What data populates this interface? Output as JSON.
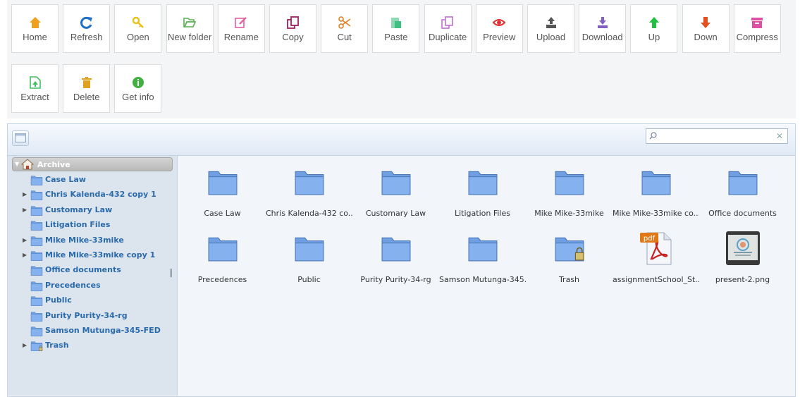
{
  "toolbar": {
    "buttons": [
      {
        "label": "Home",
        "icon": "home-icon",
        "color": "#f0a020"
      },
      {
        "label": "Refresh",
        "icon": "refresh-icon",
        "color": "#1e70c8"
      },
      {
        "label": "Open",
        "icon": "key-icon",
        "color": "#e8c020"
      },
      {
        "label": "New folder",
        "icon": "folder-open-icon",
        "color": "#58b050"
      },
      {
        "label": "Rename",
        "icon": "edit-icon",
        "color": "#e060a0"
      },
      {
        "label": "Copy",
        "icon": "copy-icon",
        "color": "#a02060"
      },
      {
        "label": "Cut",
        "icon": "scissors-icon",
        "color": "#e08020"
      },
      {
        "label": "Paste",
        "icon": "paste-icon",
        "color": "#40c080"
      },
      {
        "label": "Duplicate",
        "icon": "duplicate-icon",
        "color": "#c070d0"
      },
      {
        "label": "Preview",
        "icon": "eye-icon",
        "color": "#e03030"
      },
      {
        "label": "Upload",
        "icon": "upload-icon",
        "color": "#555555"
      },
      {
        "label": "Download",
        "icon": "download-icon",
        "color": "#8060c0"
      },
      {
        "label": "Up",
        "icon": "arrow-up-icon",
        "color": "#20c040"
      },
      {
        "label": "Down",
        "icon": "arrow-down-icon",
        "color": "#e05020"
      },
      {
        "label": "Compress",
        "icon": "archive-icon",
        "color": "#e050a0"
      },
      {
        "label": "Extract",
        "icon": "extract-icon",
        "color": "#40c060"
      },
      {
        "label": "Delete",
        "icon": "trash-icon",
        "color": "#e0a020"
      },
      {
        "label": "Get info",
        "icon": "info-icon",
        "color": "#40b040"
      }
    ]
  },
  "search": {
    "value": "",
    "placeholder": ""
  },
  "tree": {
    "root": "Archive",
    "items": [
      {
        "label": "Case Law",
        "expandable": false,
        "icon": "folder-icon"
      },
      {
        "label": "Chris Kalenda-432 copy 1",
        "expandable": true,
        "icon": "folder-icon"
      },
      {
        "label": "Customary Law",
        "expandable": true,
        "icon": "folder-icon"
      },
      {
        "label": "Litigation Files",
        "expandable": false,
        "icon": "folder-icon"
      },
      {
        "label": "Mike Mike-33mike",
        "expandable": true,
        "icon": "folder-icon"
      },
      {
        "label": "Mike Mike-33mike copy 1",
        "expandable": true,
        "icon": "folder-icon"
      },
      {
        "label": "Office documents",
        "expandable": false,
        "icon": "folder-icon"
      },
      {
        "label": "Precedences",
        "expandable": false,
        "icon": "folder-icon"
      },
      {
        "label": "Public",
        "expandable": false,
        "icon": "folder-icon"
      },
      {
        "label": "Purity Purity-34-rg",
        "expandable": false,
        "icon": "folder-icon"
      },
      {
        "label": "Samson Mutunga-345-FED",
        "expandable": false,
        "icon": "folder-icon"
      },
      {
        "label": "Trash",
        "expandable": true,
        "icon": "trash-folder-icon"
      }
    ]
  },
  "files": [
    {
      "name": "Case Law",
      "type": "folder"
    },
    {
      "name": "Chris Kalenda-432 co...",
      "type": "folder"
    },
    {
      "name": "Customary Law",
      "type": "folder"
    },
    {
      "name": "Litigation Files",
      "type": "folder"
    },
    {
      "name": "Mike Mike-33mike",
      "type": "folder"
    },
    {
      "name": "Mike Mike-33mike co...",
      "type": "folder"
    },
    {
      "name": "Office documents",
      "type": "folder"
    },
    {
      "name": "Precedences",
      "type": "folder"
    },
    {
      "name": "Public",
      "type": "folder"
    },
    {
      "name": "Purity Purity-34-rg",
      "type": "folder"
    },
    {
      "name": "Samson Mutunga-345...",
      "type": "folder"
    },
    {
      "name": "Trash",
      "type": "trash-folder"
    },
    {
      "name": "assignmentSchool_St...",
      "type": "pdf",
      "badge": "pdf"
    },
    {
      "name": "present-2.png",
      "type": "image"
    }
  ],
  "colors": {
    "folder": "#6f9fe0",
    "tree_text": "#2a6aaa",
    "accent_border": "#c5d4e4"
  }
}
